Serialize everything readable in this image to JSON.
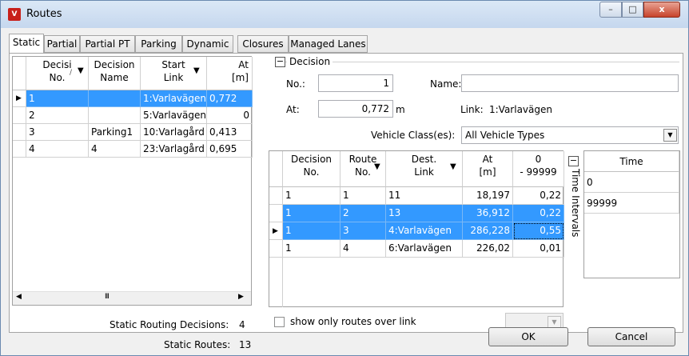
{
  "window": {
    "title": "Routes",
    "app_icon": "vissim-icon",
    "controls": {
      "minimize": "–",
      "maximize": "□",
      "close": "x"
    }
  },
  "tabs": [
    {
      "label": "Static"
    },
    {
      "label": "Partial"
    },
    {
      "label": "Partial PT"
    },
    {
      "label": "Parking"
    },
    {
      "label": "Dynamic"
    },
    {
      "label": "Closures"
    },
    {
      "label": "Managed Lanes"
    }
  ],
  "decisions_grid": {
    "headers": {
      "no": [
        "Decisi",
        "No."
      ],
      "name": [
        "Decision",
        "Name"
      ],
      "start_link": [
        "Start",
        "Link"
      ],
      "at": [
        "At",
        "[m]"
      ]
    },
    "rows": [
      {
        "no": "1",
        "name": "",
        "start_link": "1:Varlavägen",
        "at": "0,772"
      },
      {
        "no": "2",
        "name": "",
        "start_link": "5:Varlavägen",
        "at": "0"
      },
      {
        "no": "3",
        "name": "Parking1",
        "start_link": "10:Varlagård",
        "at": "0,413"
      },
      {
        "no": "4",
        "name": "4",
        "start_link": "23:Varlagård",
        "at": "0,695"
      }
    ],
    "scroll_thumb": "III"
  },
  "decision_panel": {
    "title": "Decision",
    "no_label": "No.:",
    "no_value": "1",
    "name_label": "Name:",
    "name_value": "",
    "at_label": "At:",
    "at_value": "0,772",
    "at_unit": "m",
    "link_label": "Link:",
    "link_value": "1:Varlavägen",
    "vehicle_class_label": "Vehicle Class(es):",
    "vehicle_class_value": "All Vehicle Types"
  },
  "routes_grid": {
    "headers": {
      "decision_no": [
        "Decision",
        "No."
      ],
      "route_no": [
        "Route",
        "No."
      ],
      "dest_link": [
        "Dest.",
        "Link"
      ],
      "at": [
        "At",
        "[m]"
      ],
      "interval": [
        "0",
        "- 99999"
      ]
    },
    "rows": [
      {
        "decision_no": "1",
        "route_no": "1",
        "dest_link": "11",
        "at": "18,197",
        "interval": "0,22"
      },
      {
        "decision_no": "1",
        "route_no": "2",
        "dest_link": "13",
        "at": "36,912",
        "interval": "0,22"
      },
      {
        "decision_no": "1",
        "route_no": "3",
        "dest_link": "4:Varlavägen",
        "at": "286,228",
        "interval": "0,55"
      },
      {
        "decision_no": "1",
        "route_no": "4",
        "dest_link": "6:Varlavägen",
        "at": "226,02",
        "interval": "0,01"
      }
    ]
  },
  "time_intervals": {
    "side_label": "Time Intervals",
    "header": "Time",
    "values": [
      "0",
      "99999"
    ]
  },
  "show_only_routes": {
    "label": "show only routes over link",
    "checked": false
  },
  "footer": {
    "decisions_label": "Static Routing Decisions:",
    "decisions_value": "4",
    "routes_label": "Static Routes:",
    "routes_value": "13",
    "ok": "OK",
    "cancel": "Cancel"
  },
  "colors": {
    "selection": "#3399ff",
    "titlebar": "#c5d7ee",
    "close_button": "#c7432b"
  }
}
